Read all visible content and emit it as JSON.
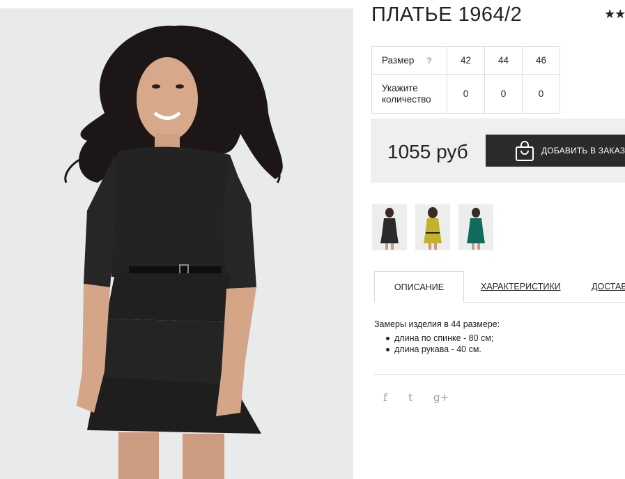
{
  "product": {
    "title": "ПЛАТЬЕ 1964/2",
    "rating_stars": "★★",
    "price": "1055 руб",
    "add_to_cart_label": "ДОБАВИТЬ В ЗАКАЗ"
  },
  "size_table": {
    "size_label": "Размер",
    "help_label": "?",
    "quantity_label_line1": "Укажите",
    "quantity_label_line2": "количество",
    "sizes": [
      "42",
      "44",
      "46"
    ],
    "quantities": [
      "0",
      "0",
      "0"
    ]
  },
  "thumbnails": [
    {
      "color_name": "black",
      "dress_color": "#2a2a2a"
    },
    {
      "color_name": "mustard",
      "dress_color": "#c4b22a"
    },
    {
      "color_name": "teal",
      "dress_color": "#0f6b5b"
    }
  ],
  "tabs": [
    {
      "label": "ОПИСАНИЕ",
      "active": true
    },
    {
      "label": "ХАРАКТЕРИСТИКИ",
      "active": false
    },
    {
      "label": "ДОСТАВ",
      "active": false
    }
  ],
  "description": {
    "intro": "Замеры изделия в 44 размере:",
    "items": [
      "длина по спинке - 80 см;",
      "длина рукава - 40 см."
    ]
  },
  "social": [
    {
      "icon": "facebook-icon",
      "glyph": "f"
    },
    {
      "icon": "twitter-icon",
      "glyph": "t"
    },
    {
      "icon": "google-plus-icon",
      "glyph": "g+"
    }
  ],
  "colors": {
    "button_bg": "#2b2b2b",
    "buy_block_bg": "#efefef",
    "photo_bg": "#e9eaec",
    "table_border": "#dcdcdc"
  }
}
